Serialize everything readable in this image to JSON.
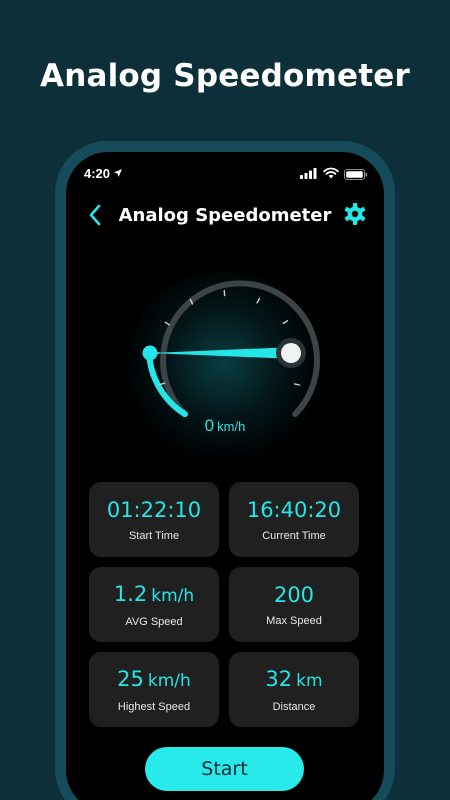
{
  "promo": {
    "headline": "Analog Speedometer"
  },
  "status_bar": {
    "time": "4:20"
  },
  "app_bar": {
    "title": "Analog Speedometer"
  },
  "speedometer": {
    "speed": "0",
    "unit": "km/h",
    "accent_color": "#25e6e6"
  },
  "stats": [
    {
      "value": "01:22:10",
      "unit": "",
      "label": "Start Time"
    },
    {
      "value": "16:40:20",
      "unit": "",
      "label": "Current Time"
    },
    {
      "value": "1.2",
      "unit": "km/h",
      "label": "AVG Speed"
    },
    {
      "value": "200",
      "unit": "",
      "label": "Max Speed"
    },
    {
      "value": "25",
      "unit": "km/h",
      "label": "Highest Speed"
    },
    {
      "value": "32",
      "unit": "km",
      "label": "Distance"
    }
  ],
  "start_button": {
    "label": "Start"
  }
}
